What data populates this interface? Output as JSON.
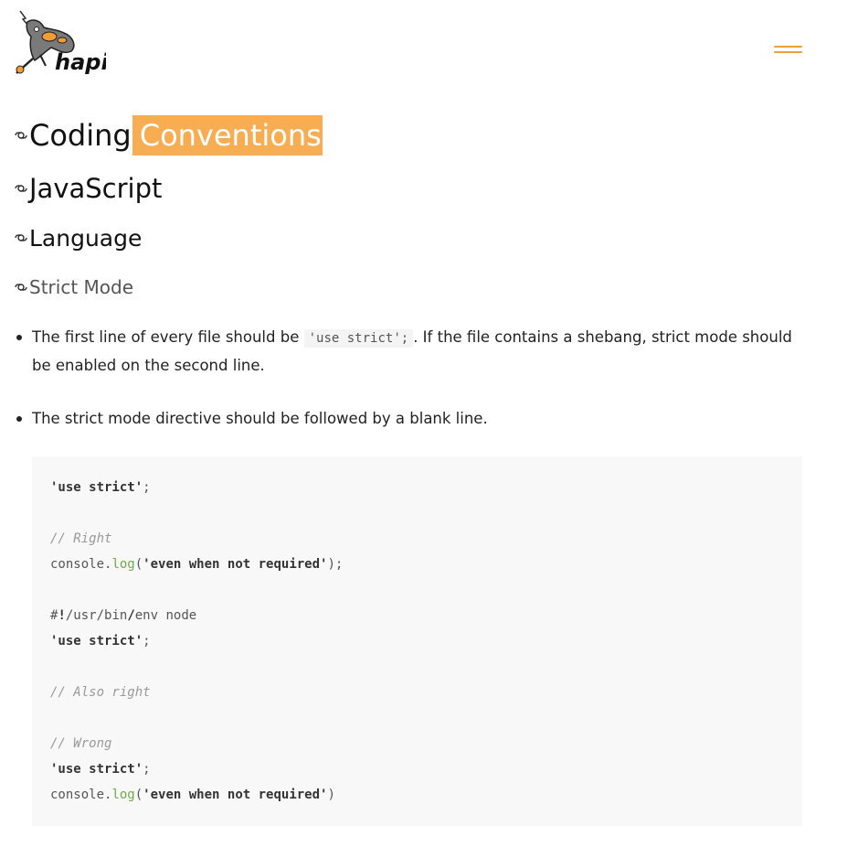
{
  "header": {
    "logo_text": "hapi",
    "menu_icon": "hamburger-menu-icon",
    "accent_color": "#f19c35"
  },
  "headings": {
    "h1_part1": "Coding",
    "h1_part2": "Conventions",
    "h2": "JavaScript",
    "h3": "Language",
    "h4": "Strict Mode",
    "anchor_icon": "link-icon"
  },
  "list": {
    "item1_before": "The first line of every file should be ",
    "item1_code": "'use strict';",
    "item1_after": ". If the file contains a shebang, strict mode should be enabled on the second line.",
    "item2": "The strict mode directive should be followed by a blank line."
  },
  "code": {
    "use_strict": "'use strict'",
    "semicolon": ";",
    "comment_right": "// Right",
    "console": "console.",
    "log": "log",
    "open_paren": "(",
    "arg": "'even when not required'",
    "close_semi": ");",
    "close_paren": ")",
    "shebang_hash": "#",
    "shebang_bang": "!",
    "shebang_path1": "/usr/bin",
    "shebang_slash": "/",
    "shebang_rest": "env node",
    "comment_also": "// Also right",
    "comment_wrong": "// Wrong"
  }
}
